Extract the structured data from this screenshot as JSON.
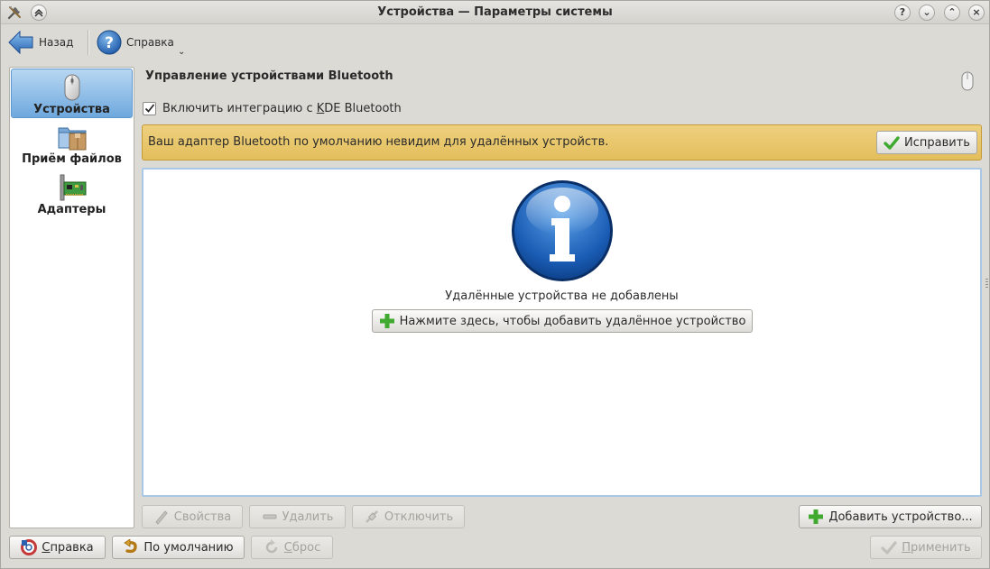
{
  "window": {
    "title": "Устройства — Параметры системы",
    "controls": {
      "help": "?",
      "minimize": "⌄",
      "maximize": "⌃",
      "close": "×"
    }
  },
  "toolbar": {
    "back_label": "Назад",
    "help_label": "Справка",
    "help_menu_arrow": "⌄"
  },
  "sidebar": {
    "items": [
      {
        "label": "Устройства",
        "icon": "mouse-icon",
        "selected": true
      },
      {
        "label": "Приём файлов",
        "icon": "file-receive-icon",
        "selected": false
      },
      {
        "label": "Адаптеры",
        "icon": "adapter-card-icon",
        "selected": false
      }
    ]
  },
  "main": {
    "header_title": "Управление устройствами Bluetooth",
    "integration_checkbox": {
      "checked": true,
      "label_before": "Включить интеграцию с ",
      "label_accel": "K",
      "label_after": "DE Bluetooth"
    },
    "banner": {
      "text": "Ваш адаптер Bluetooth по умолчанию невидим для удалённых устройств.",
      "fix_button": "Исправить"
    },
    "device_list": {
      "empty_text": "Удалённые устройства не добавлены",
      "add_link_button": "Нажмите здесь, чтобы добавить удалённое устройство"
    },
    "actions": {
      "properties": "Свойства",
      "remove": "Удалить",
      "disconnect": "Отключить",
      "add_device": "Добавить устройство..."
    }
  },
  "footer": {
    "help": {
      "accel": "С",
      "rest": "правка"
    },
    "defaults": "По умолчанию",
    "reset": {
      "accel": "С",
      "rest": "брос"
    },
    "apply": {
      "accel": "П",
      "rest": "рименить"
    }
  },
  "colors": {
    "accent_selection": "#6ea8de",
    "warning_banner": "#e3be5c",
    "success_green": "#3faa2f"
  }
}
